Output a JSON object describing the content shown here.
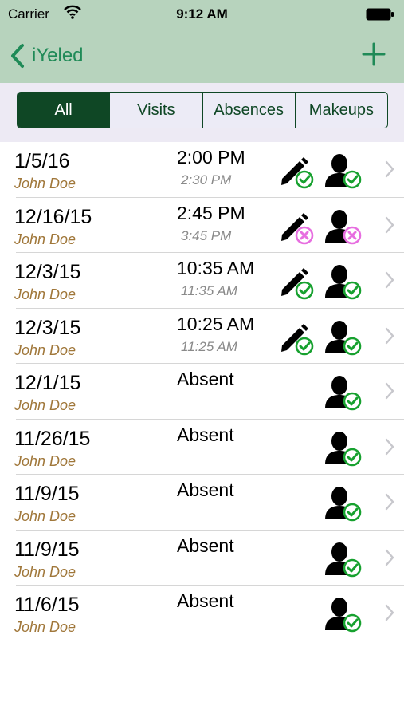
{
  "status": {
    "carrier": "Carrier",
    "time": "9:12 AM"
  },
  "nav": {
    "back_label": "iYeled"
  },
  "segments": [
    {
      "label": "All",
      "active": true
    },
    {
      "label": "Visits",
      "active": false
    },
    {
      "label": "Absences",
      "active": false
    },
    {
      "label": "Makeups",
      "active": false
    }
  ],
  "rows": [
    {
      "date": "1/5/16",
      "name": "John Doe",
      "start": "2:00 PM",
      "end": "2:30 PM",
      "pencil": "check",
      "person": "check"
    },
    {
      "date": "12/16/15",
      "name": "John Doe",
      "start": "2:45 PM",
      "end": "3:45 PM",
      "pencil": "x",
      "person": "x"
    },
    {
      "date": "12/3/15",
      "name": "John Doe",
      "start": "10:35 AM",
      "end": "11:35 AM",
      "pencil": "check",
      "person": "check"
    },
    {
      "date": "12/3/15",
      "name": "John Doe",
      "start": "10:25 AM",
      "end": "11:25 AM",
      "pencil": "check",
      "person": "check"
    },
    {
      "date": "12/1/15",
      "name": "John Doe",
      "start": "Absent",
      "end": "",
      "pencil": "",
      "person": "check"
    },
    {
      "date": "11/26/15",
      "name": "John Doe",
      "start": "Absent",
      "end": "",
      "pencil": "",
      "person": "check"
    },
    {
      "date": "11/9/15",
      "name": "John Doe",
      "start": "Absent",
      "end": "",
      "pencil": "",
      "person": "check"
    },
    {
      "date": "11/9/15",
      "name": "John Doe",
      "start": "Absent",
      "end": "",
      "pencil": "",
      "person": "check"
    },
    {
      "date": "11/6/15",
      "name": "John Doe",
      "start": "Absent",
      "end": "",
      "pencil": "",
      "person": "check"
    }
  ],
  "colors": {
    "bar": "#b7d3bd",
    "accent": "#1f8a57",
    "segment_dark": "#0f4725",
    "name": "#a0773a",
    "check": "#17a12f",
    "cross": "#e76ee0"
  }
}
